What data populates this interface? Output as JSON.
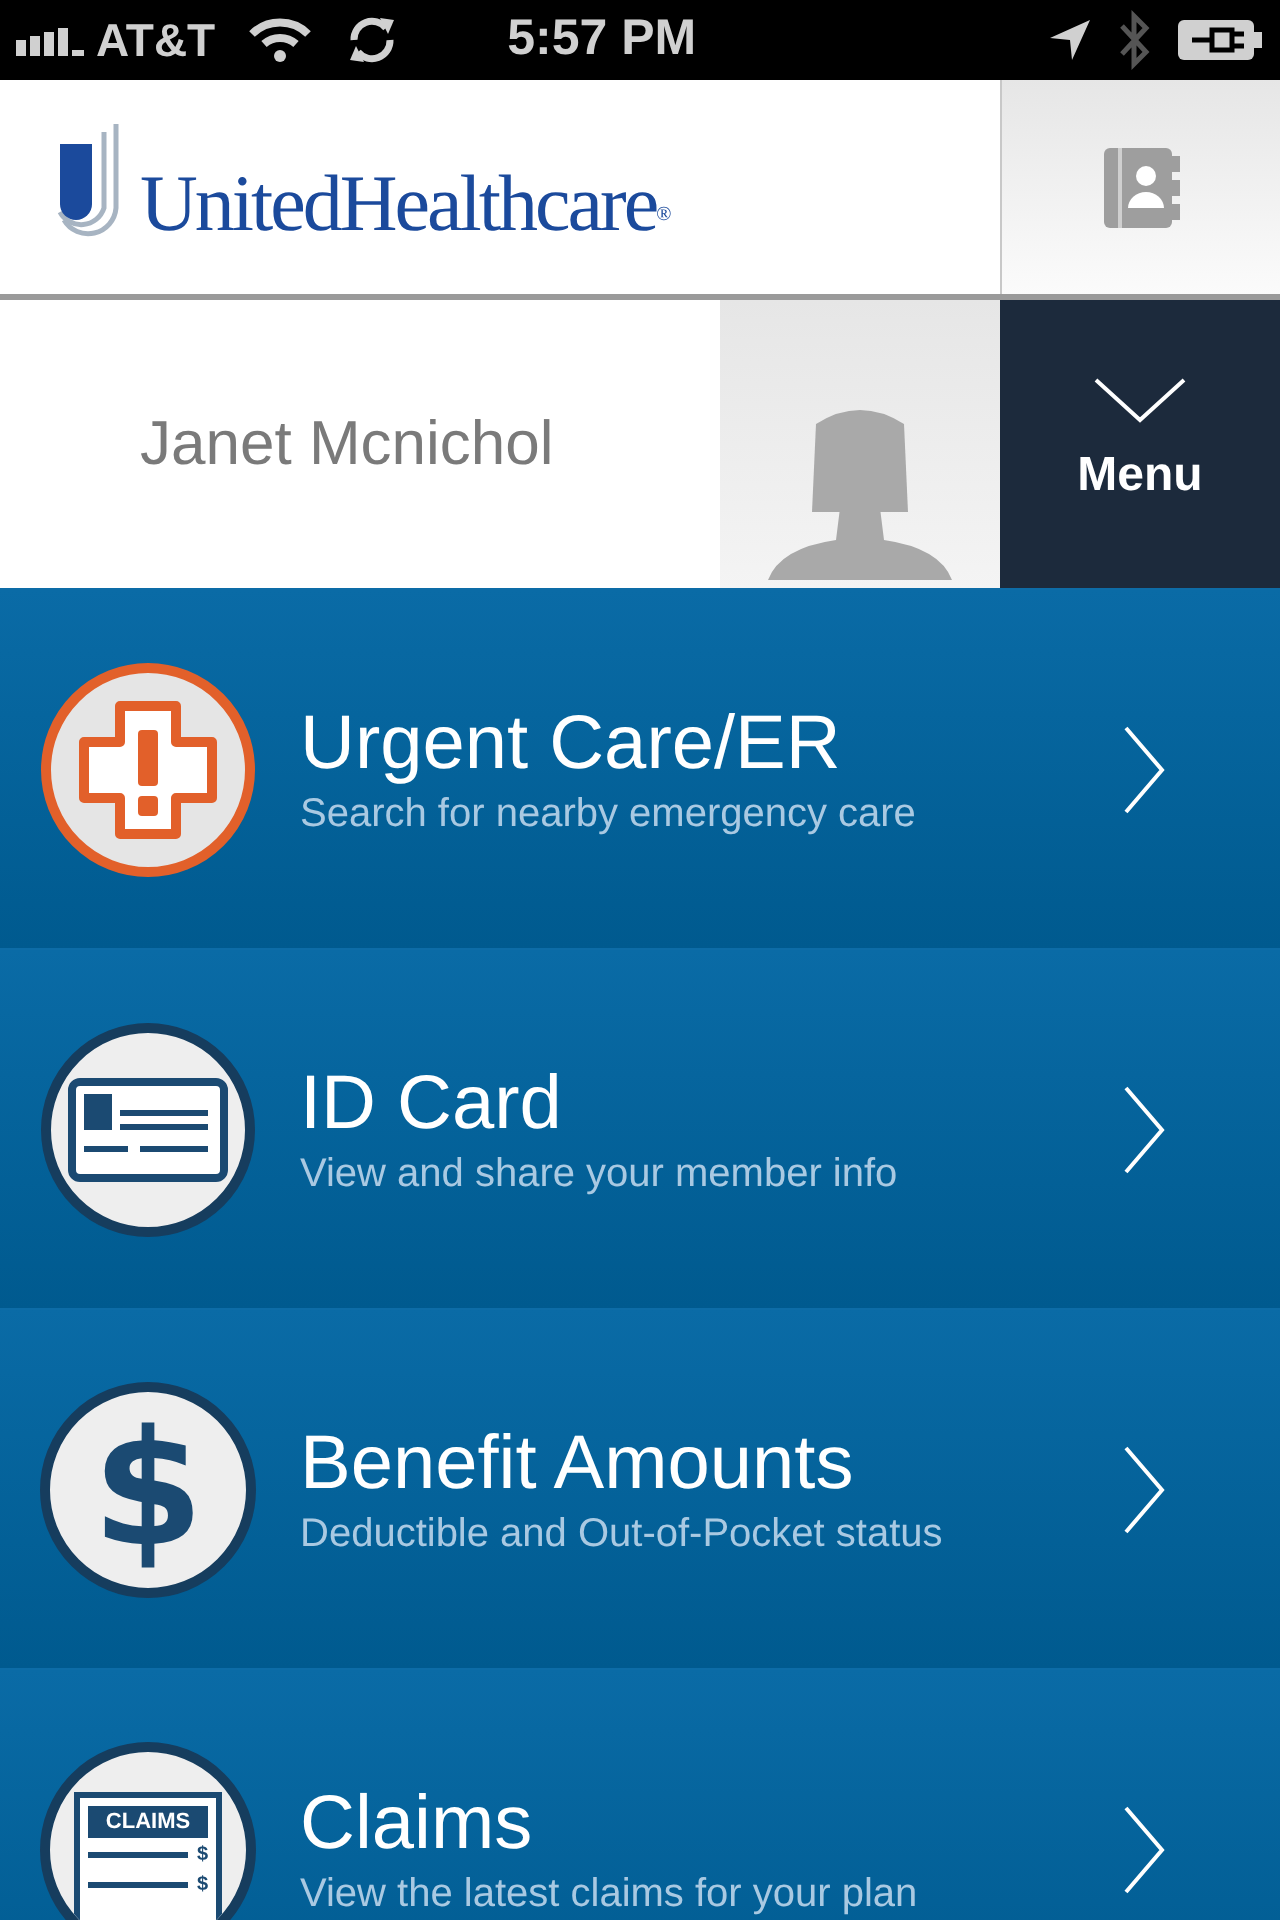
{
  "status_bar": {
    "carrier": "AT&T",
    "time": "5:57 PM"
  },
  "header": {
    "logo_text": "UnitedHealthcare",
    "logo_mark": "®"
  },
  "user": {
    "name": "Janet Mcnichol",
    "menu_label": "Menu"
  },
  "items": [
    {
      "kind": "urgent",
      "title": "Urgent Care/ER",
      "subtitle": "Search for nearby emergency care"
    },
    {
      "kind": "id_card",
      "title": "ID Card",
      "subtitle": "View and share your member info"
    },
    {
      "kind": "benefits",
      "title": "Benefit Amounts",
      "subtitle": "Deductible and Out-of-Pocket status",
      "icon_text": "$"
    },
    {
      "kind": "claims",
      "title": "Claims",
      "subtitle": "View the latest claims for your plan",
      "icon_text": "CLAIMS",
      "icon_marks": [
        "$",
        "$"
      ]
    }
  ]
}
